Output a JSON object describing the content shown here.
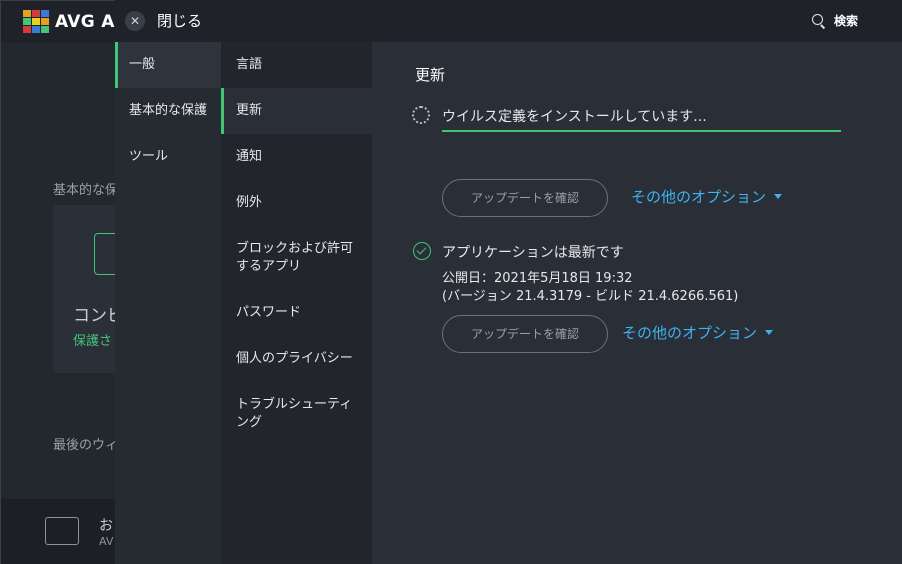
{
  "background_app": {
    "app_name": "AVG An",
    "section_label": "基本的な保",
    "card_title": "コンピ",
    "card_status": "保護さ",
    "last_scan_label": "最後のウィ",
    "footer_title": "お",
    "footer_sub": "AV"
  },
  "header": {
    "close_label": "閉じる",
    "search_label": "検索"
  },
  "nav_primary": {
    "items": [
      {
        "label": "一般",
        "active": true
      },
      {
        "label": "基本的な保護",
        "active": false
      },
      {
        "label": "ツール",
        "active": false
      }
    ]
  },
  "nav_secondary": {
    "items": [
      {
        "label": "言語",
        "active": false
      },
      {
        "label": "更新",
        "active": true
      },
      {
        "label": "通知",
        "active": false
      },
      {
        "label": "例外",
        "active": false
      },
      {
        "label": "ブロックおよび許可するアプリ",
        "active": false
      },
      {
        "label": "パスワード",
        "active": false
      },
      {
        "label": "個人のプライバシー",
        "active": false
      },
      {
        "label": "トラブルシューティング",
        "active": false
      }
    ]
  },
  "content": {
    "title": "更新",
    "virus_definitions": {
      "status_text": "ウイルス定義をインストールしています...",
      "check_button": "アップデートを確認",
      "more_options": "その他のオプション"
    },
    "application": {
      "status_text": "アプリケーションは最新です",
      "published": "公開日：2021年5月18日 19:32",
      "version": "(バージョン 21.4.3179 - ビルド 21.4.6266.561)",
      "check_button": "アップデートを確認",
      "more_options": "その他のオプション"
    }
  },
  "colors": {
    "accent_green": "#43c47a",
    "link_blue": "#3fb3f2",
    "background": "#2a2e36"
  }
}
